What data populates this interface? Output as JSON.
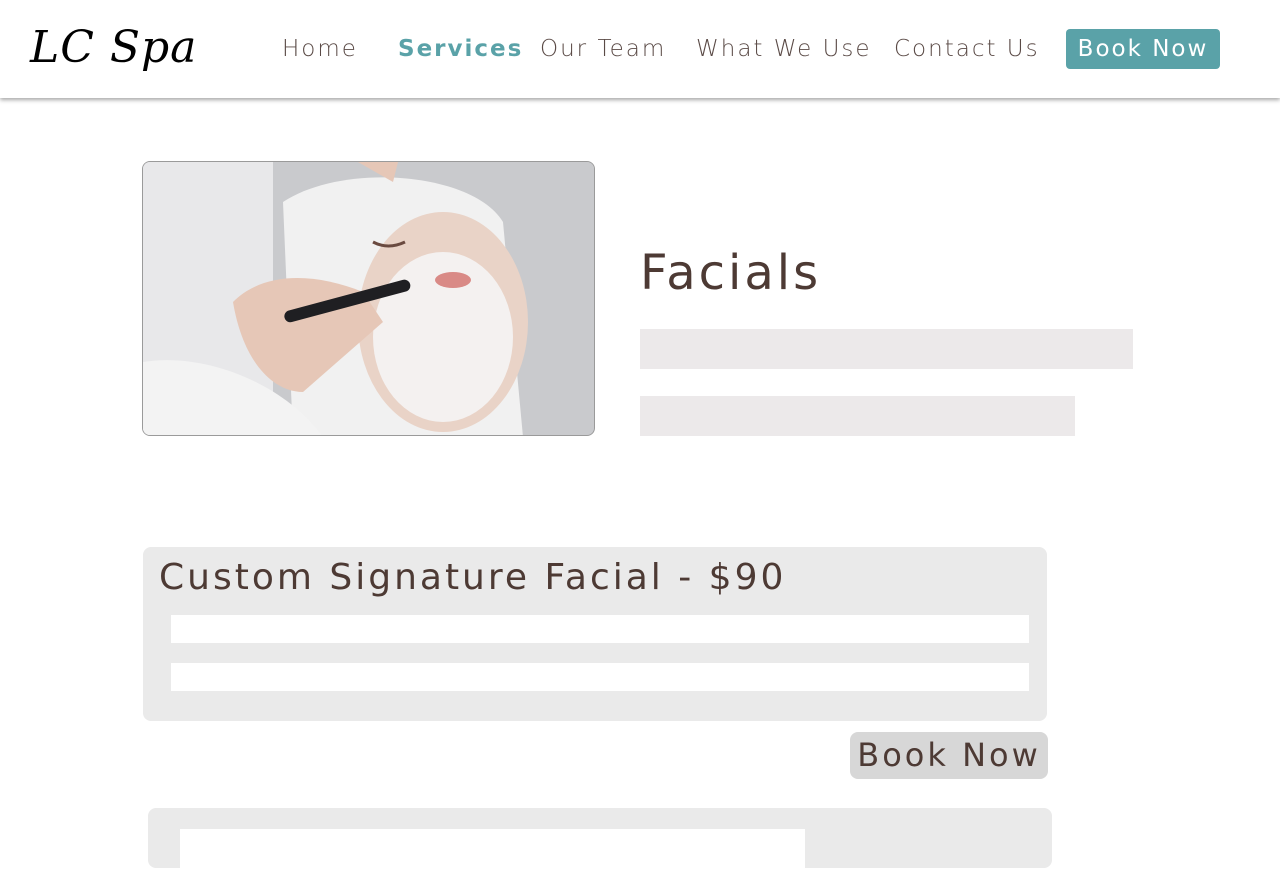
{
  "header": {
    "logo": "LC Spa",
    "nav": {
      "home": "Home",
      "services": "Services",
      "our_team": "Our Team",
      "what_we_use": "What We Use",
      "contact_us": "Contact Us"
    },
    "book_now": "Book Now",
    "active_item": "Services"
  },
  "hero": {
    "title": "Facials",
    "image_icon": "facial-treatment-photo"
  },
  "services": [
    {
      "title": "Custom Signature Facial - $90",
      "book_label": "Book Now"
    }
  ],
  "colors": {
    "accent": "#5aa2a8",
    "text": "#4d3a34",
    "card_bg": "#eaeaea",
    "button_grey": "#d7d7d7"
  }
}
